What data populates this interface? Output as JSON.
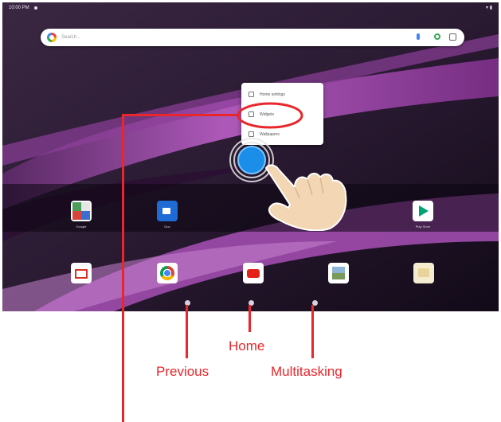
{
  "status_bar": {
    "time": "10:00 PM",
    "right_icons": "▾ ▮"
  },
  "search_bar": {
    "placeholder": "Search...",
    "icons": [
      "google-g-icon",
      "mic-icon",
      "lens-icon",
      "ai-mode-icon"
    ]
  },
  "context_menu": {
    "items": [
      {
        "label": "Home settings",
        "icon": "settings-icon"
      },
      {
        "label": "Widgets",
        "icon": "widgets-icon"
      },
      {
        "label": "Wallpapers",
        "icon": "wallpaper-icon"
      }
    ],
    "highlighted_item": "Widgets"
  },
  "apps": [
    {
      "label": "Google",
      "icon": "gallery-icon"
    },
    {
      "label": "Duo",
      "icon": "duo-icon"
    },
    {
      "label": "Play Store",
      "icon": "play-store-icon"
    },
    {
      "label": "",
      "icon": "gmail-icon"
    },
    {
      "label": "",
      "icon": "chrome-icon"
    },
    {
      "label": "",
      "icon": "youtube-icon"
    },
    {
      "label": "",
      "icon": "photos-icon"
    },
    {
      "label": "",
      "icon": "files-icon"
    }
  ],
  "nav_buttons": [
    {
      "label": "Previous",
      "icon": "previous-dot-icon"
    },
    {
      "label": "Home",
      "icon": "home-dot-icon"
    },
    {
      "label": "Multitasking",
      "icon": "multitasking-dot-icon"
    }
  ],
  "annotation": {
    "color": "#e8262b",
    "gesture": "long-press"
  },
  "colors": {
    "wallpaper_dark": "#1b0f22",
    "wallpaper_accent": "#9a3fa6",
    "touch_blue": "#1a8ee8"
  }
}
